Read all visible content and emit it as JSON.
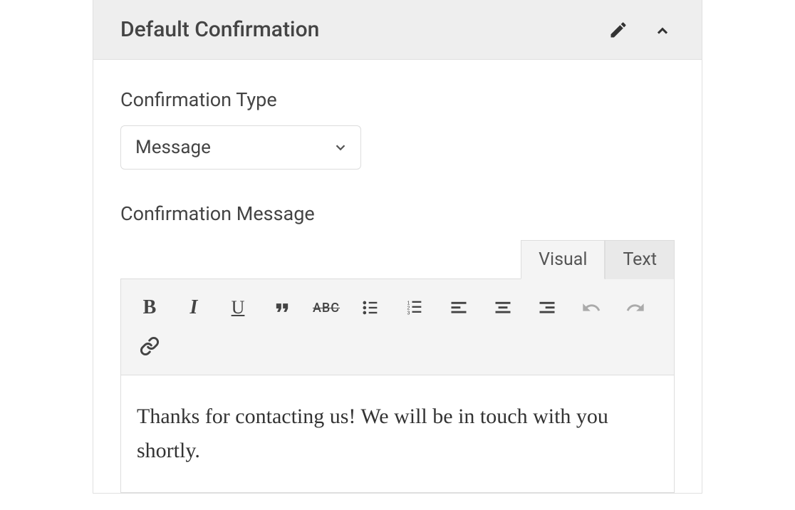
{
  "panel": {
    "title": "Default Confirmation"
  },
  "fields": {
    "type_label": "Confirmation Type",
    "type_value": "Message",
    "message_label": "Confirmation Message"
  },
  "editor": {
    "tabs": {
      "visual": "Visual",
      "text": "Text",
      "active": "visual"
    },
    "toolbar": {
      "bold": "B",
      "italic": "I",
      "underline": "U",
      "strike": "ABC"
    },
    "content": "Thanks for contacting us! We will be in touch with you shortly."
  }
}
